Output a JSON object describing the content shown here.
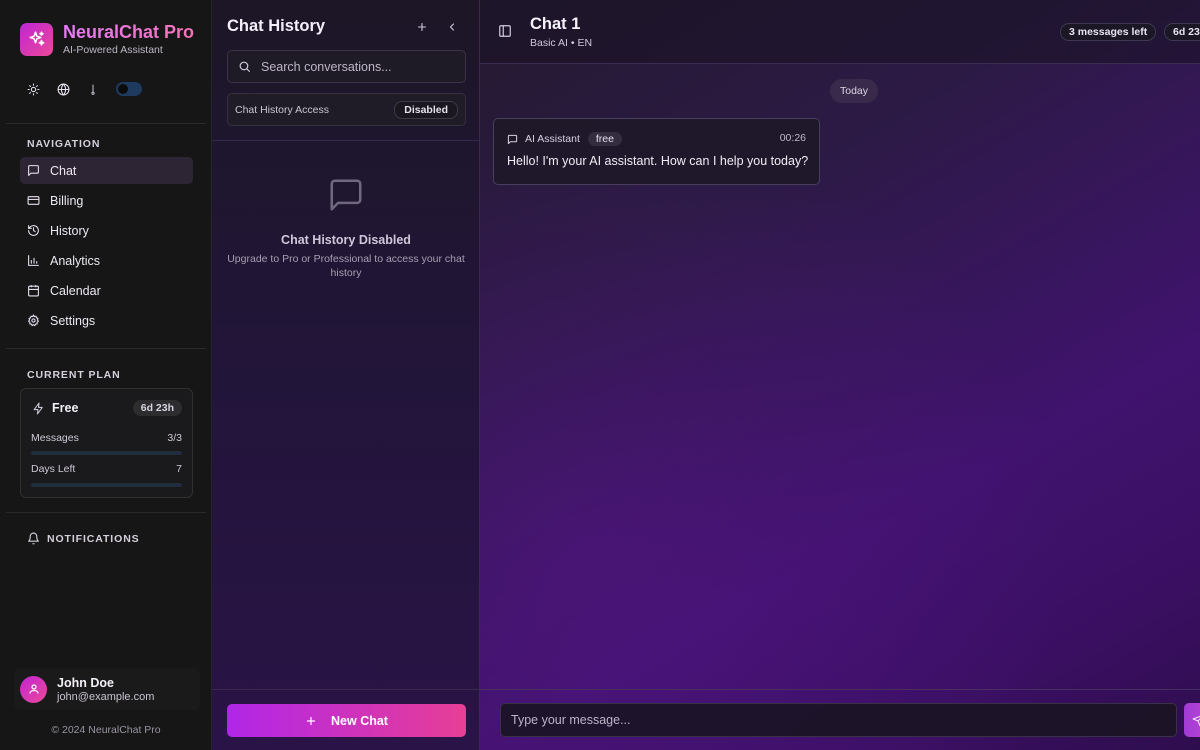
{
  "brand": {
    "title": "NeuralChat Pro",
    "subtitle": "AI-Powered Assistant"
  },
  "sidebar": {
    "navigation_title": "NAVIGATION",
    "nav_items": [
      {
        "label": "Chat",
        "icon": "message-square-icon",
        "active": true
      },
      {
        "label": "Billing",
        "icon": "credit-card-icon",
        "active": false
      },
      {
        "label": "History",
        "icon": "history-icon",
        "active": false
      },
      {
        "label": "Analytics",
        "icon": "bar-chart-icon",
        "active": false
      },
      {
        "label": "Calendar",
        "icon": "calendar-icon",
        "active": false
      },
      {
        "label": "Settings",
        "icon": "gear-icon",
        "active": false
      }
    ],
    "plan_title": "CURRENT PLAN",
    "plan": {
      "name": "Free",
      "time_left": "6d 23h",
      "messages_label": "Messages",
      "messages_value": "3/3",
      "messages_progress": 0,
      "days_label": "Days Left",
      "days_value": "7",
      "days_progress": 0
    },
    "notifications_title": "NOTIFICATIONS",
    "user": {
      "name": "John Doe",
      "email": "john@example.com"
    },
    "copyright": "© 2024 NeuralChat Pro"
  },
  "history": {
    "title": "Chat History",
    "search_placeholder": "Search conversations...",
    "access_label": "Chat History Access",
    "access_status": "Disabled",
    "empty_title": "Chat History Disabled",
    "empty_desc": "Upgrade to Pro or Professional to access your chat history",
    "new_chat_label": "New Chat"
  },
  "chat": {
    "title": "Chat 1",
    "subtitle": "Basic AI • EN",
    "messages_left": "3 messages left",
    "time_left": "6d 23",
    "date_divider": "Today",
    "messages": [
      {
        "sender": "AI Assistant",
        "tag": "free",
        "time": "00:26",
        "text": "Hello! I'm your AI assistant. How can I help you today?"
      }
    ],
    "input_placeholder": "Type your message..."
  },
  "colors": {
    "accent_start": "#b026e8",
    "accent_end": "#e83e95",
    "brand_gradient": "#e879f9"
  }
}
